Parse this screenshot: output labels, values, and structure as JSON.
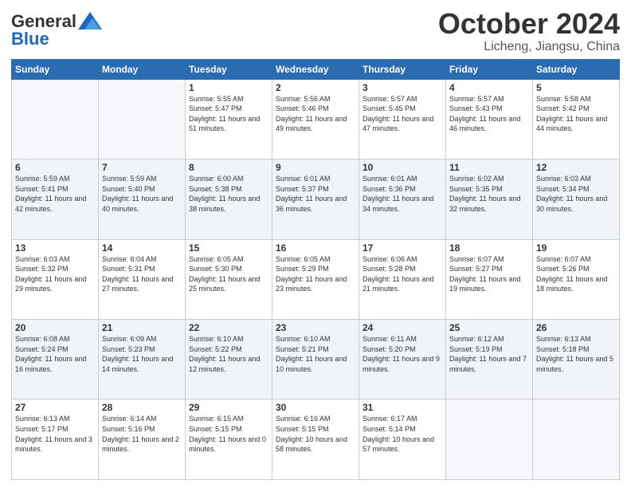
{
  "header": {
    "logo_general": "General",
    "logo_blue": "Blue",
    "month_title": "October 2024",
    "location": "Licheng, Jiangsu, China"
  },
  "weekdays": [
    "Sunday",
    "Monday",
    "Tuesday",
    "Wednesday",
    "Thursday",
    "Friday",
    "Saturday"
  ],
  "weeks": [
    [
      {
        "day": "",
        "info": ""
      },
      {
        "day": "",
        "info": ""
      },
      {
        "day": "1",
        "info": "Sunrise: 5:55 AM\nSunset: 5:47 PM\nDaylight: 11 hours and 51 minutes."
      },
      {
        "day": "2",
        "info": "Sunrise: 5:56 AM\nSunset: 5:46 PM\nDaylight: 11 hours and 49 minutes."
      },
      {
        "day": "3",
        "info": "Sunrise: 5:57 AM\nSunset: 5:45 PM\nDaylight: 11 hours and 47 minutes."
      },
      {
        "day": "4",
        "info": "Sunrise: 5:57 AM\nSunset: 5:43 PM\nDaylight: 11 hours and 46 minutes."
      },
      {
        "day": "5",
        "info": "Sunrise: 5:58 AM\nSunset: 5:42 PM\nDaylight: 11 hours and 44 minutes."
      }
    ],
    [
      {
        "day": "6",
        "info": "Sunrise: 5:59 AM\nSunset: 5:41 PM\nDaylight: 11 hours and 42 minutes."
      },
      {
        "day": "7",
        "info": "Sunrise: 5:59 AM\nSunset: 5:40 PM\nDaylight: 11 hours and 40 minutes."
      },
      {
        "day": "8",
        "info": "Sunrise: 6:00 AM\nSunset: 5:38 PM\nDaylight: 11 hours and 38 minutes."
      },
      {
        "day": "9",
        "info": "Sunrise: 6:01 AM\nSunset: 5:37 PM\nDaylight: 11 hours and 36 minutes."
      },
      {
        "day": "10",
        "info": "Sunrise: 6:01 AM\nSunset: 5:36 PM\nDaylight: 11 hours and 34 minutes."
      },
      {
        "day": "11",
        "info": "Sunrise: 6:02 AM\nSunset: 5:35 PM\nDaylight: 11 hours and 32 minutes."
      },
      {
        "day": "12",
        "info": "Sunrise: 6:03 AM\nSunset: 5:34 PM\nDaylight: 11 hours and 30 minutes."
      }
    ],
    [
      {
        "day": "13",
        "info": "Sunrise: 6:03 AM\nSunset: 5:32 PM\nDaylight: 11 hours and 29 minutes."
      },
      {
        "day": "14",
        "info": "Sunrise: 6:04 AM\nSunset: 5:31 PM\nDaylight: 11 hours and 27 minutes."
      },
      {
        "day": "15",
        "info": "Sunrise: 6:05 AM\nSunset: 5:30 PM\nDaylight: 11 hours and 25 minutes."
      },
      {
        "day": "16",
        "info": "Sunrise: 6:05 AM\nSunset: 5:29 PM\nDaylight: 11 hours and 23 minutes."
      },
      {
        "day": "17",
        "info": "Sunrise: 6:06 AM\nSunset: 5:28 PM\nDaylight: 11 hours and 21 minutes."
      },
      {
        "day": "18",
        "info": "Sunrise: 6:07 AM\nSunset: 5:27 PM\nDaylight: 11 hours and 19 minutes."
      },
      {
        "day": "19",
        "info": "Sunrise: 6:07 AM\nSunset: 5:26 PM\nDaylight: 11 hours and 18 minutes."
      }
    ],
    [
      {
        "day": "20",
        "info": "Sunrise: 6:08 AM\nSunset: 5:24 PM\nDaylight: 11 hours and 16 minutes."
      },
      {
        "day": "21",
        "info": "Sunrise: 6:09 AM\nSunset: 5:23 PM\nDaylight: 11 hours and 14 minutes."
      },
      {
        "day": "22",
        "info": "Sunrise: 6:10 AM\nSunset: 5:22 PM\nDaylight: 11 hours and 12 minutes."
      },
      {
        "day": "23",
        "info": "Sunrise: 6:10 AM\nSunset: 5:21 PM\nDaylight: 11 hours and 10 minutes."
      },
      {
        "day": "24",
        "info": "Sunrise: 6:11 AM\nSunset: 5:20 PM\nDaylight: 11 hours and 9 minutes."
      },
      {
        "day": "25",
        "info": "Sunrise: 6:12 AM\nSunset: 5:19 PM\nDaylight: 11 hours and 7 minutes."
      },
      {
        "day": "26",
        "info": "Sunrise: 6:13 AM\nSunset: 5:18 PM\nDaylight: 11 hours and 5 minutes."
      }
    ],
    [
      {
        "day": "27",
        "info": "Sunrise: 6:13 AM\nSunset: 5:17 PM\nDaylight: 11 hours and 3 minutes."
      },
      {
        "day": "28",
        "info": "Sunrise: 6:14 AM\nSunset: 5:16 PM\nDaylight: 11 hours and 2 minutes."
      },
      {
        "day": "29",
        "info": "Sunrise: 6:15 AM\nSunset: 5:15 PM\nDaylight: 11 hours and 0 minutes."
      },
      {
        "day": "30",
        "info": "Sunrise: 6:16 AM\nSunset: 5:15 PM\nDaylight: 10 hours and 58 minutes."
      },
      {
        "day": "31",
        "info": "Sunrise: 6:17 AM\nSunset: 5:14 PM\nDaylight: 10 hours and 57 minutes."
      },
      {
        "day": "",
        "info": ""
      },
      {
        "day": "",
        "info": ""
      }
    ]
  ]
}
